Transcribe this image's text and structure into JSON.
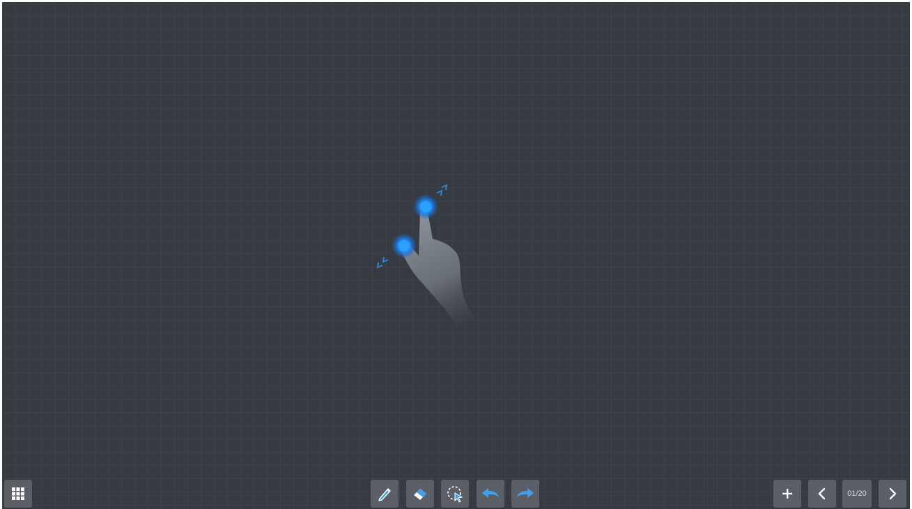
{
  "canvas": {
    "background": "#363a41",
    "grid": true
  },
  "gesture_hint": {
    "icon": "two-finger-zoom-gesture",
    "accent": "#1e90ff"
  },
  "toolbar": {
    "apps_icon": "grid-apps-icon",
    "tools": [
      {
        "name": "pen",
        "icon": "pen-icon"
      },
      {
        "name": "eraser",
        "icon": "eraser-icon"
      },
      {
        "name": "lasso-select",
        "icon": "lasso-select-icon"
      },
      {
        "name": "undo",
        "icon": "undo-arrow-icon"
      },
      {
        "name": "redo",
        "icon": "redo-arrow-icon"
      }
    ],
    "accent": "#3fa0f0",
    "button_bg": "#5b5f66"
  },
  "pager": {
    "add_icon": "plus-icon",
    "prev_icon": "chevron-left-icon",
    "page_label": "01/20",
    "next_icon": "chevron-right-icon"
  }
}
